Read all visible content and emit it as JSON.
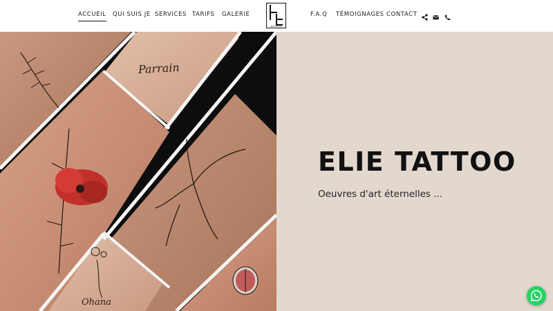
{
  "nav": {
    "left_items": [
      {
        "label": "ACCUEIL",
        "active": true
      },
      {
        "label": "QUI SUIS JE"
      },
      {
        "label": "SERVICES"
      },
      {
        "label": "TARIFS"
      },
      {
        "label": "GALERIE"
      }
    ],
    "right_items": [
      {
        "label": "F.A.Q"
      },
      {
        "label": "TÉMOIGNAGES"
      },
      {
        "label": "CONTACT"
      }
    ],
    "icons": [
      "share-icon",
      "email-icon",
      "phone-icon"
    ]
  },
  "logo": {
    "small_text": "ELIE TATTOO"
  },
  "hero": {
    "title": "ELIE TATTOO",
    "subtitle": "Oeuvres d'art éternelles ...",
    "panel_color": "#e2d8ce",
    "tattoo_texts": [
      "Parrain",
      "Ohana"
    ]
  },
  "floating": {
    "icon": "whatsapp-icon",
    "color": "#25d366"
  }
}
